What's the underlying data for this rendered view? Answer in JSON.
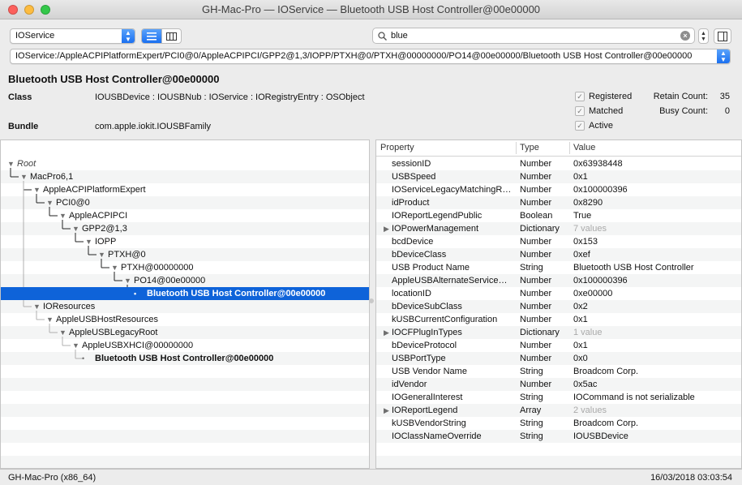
{
  "window": {
    "title": "GH-Mac-Pro — IOService — Bluetooth USB Host Controller@00e00000"
  },
  "toolbar": {
    "plane_select": "IOService",
    "search_value": "blue",
    "path": "IOService:/AppleACPIPlatformExpert/PCI0@0/AppleACPIPCI/GPP2@1,3/IOPP/PTXH@0/PTXH@00000000/PO14@00e00000/Bluetooth USB Host Controller@00e00000"
  },
  "header": {
    "title": "Bluetooth USB Host Controller@00e00000",
    "class_label": "Class",
    "class_value": "IOUSBDevice : IOUSBNub : IOService : IORegistryEntry : OSObject",
    "bundle_label": "Bundle",
    "bundle_value": "com.apple.iokit.IOUSBFamily",
    "registered": "Registered",
    "matched": "Matched",
    "active": "Active",
    "retain_label": "Retain Count:",
    "retain_value": "35",
    "busy_label": "Busy Count:",
    "busy_value": "0"
  },
  "tree": [
    {
      "label": "Root",
      "depth": 0,
      "expanded": true,
      "italic": true
    },
    {
      "label": "MacPro6,1",
      "depth": 1,
      "expanded": true
    },
    {
      "label": "AppleACPIPlatformExpert",
      "depth": 2,
      "expanded": true
    },
    {
      "label": "PCI0@0",
      "depth": 3,
      "expanded": true
    },
    {
      "label": "AppleACPIPCI",
      "depth": 4,
      "expanded": true
    },
    {
      "label": "GPP2@1,3",
      "depth": 5,
      "expanded": true
    },
    {
      "label": "IOPP",
      "depth": 6,
      "expanded": true
    },
    {
      "label": "PTXH@0",
      "depth": 7,
      "expanded": true
    },
    {
      "label": "PTXH@00000000",
      "depth": 8,
      "expanded": true
    },
    {
      "label": "PO14@00e00000",
      "depth": 9,
      "expanded": true
    },
    {
      "label": "Bluetooth USB Host Controller@00e00000",
      "depth": 10,
      "expanded": false,
      "selected": true
    },
    {
      "label": "IOResources",
      "depth": 2,
      "expanded": true
    },
    {
      "label": "AppleUSBHostResources",
      "depth": 3,
      "expanded": true
    },
    {
      "label": "AppleUSBLegacyRoot",
      "depth": 4,
      "expanded": true
    },
    {
      "label": "AppleUSBXHCI@00000000",
      "depth": 5,
      "expanded": true
    },
    {
      "label": "Bluetooth USB Host Controller@00e00000",
      "depth": 6,
      "expanded": false,
      "bold": true
    }
  ],
  "properties": {
    "columns": [
      "Property",
      "Type",
      "Value"
    ],
    "rows": [
      {
        "name": "sessionID",
        "type": "Number",
        "value": "0x63938448"
      },
      {
        "name": "USBSpeed",
        "type": "Number",
        "value": "0x1"
      },
      {
        "name": "IOServiceLegacyMatchingRegistryID",
        "type": "Number",
        "value": "0x100000396"
      },
      {
        "name": "idProduct",
        "type": "Number",
        "value": "0x8290"
      },
      {
        "name": "IOReportLegendPublic",
        "type": "Boolean",
        "value": "True"
      },
      {
        "name": "IOPowerManagement",
        "type": "Dictionary",
        "value": "7 values",
        "expandable": true,
        "muted": true
      },
      {
        "name": "bcdDevice",
        "type": "Number",
        "value": "0x153"
      },
      {
        "name": "bDeviceClass",
        "type": "Number",
        "value": "0xef"
      },
      {
        "name": "USB Product Name",
        "type": "String",
        "value": "Bluetooth USB Host Controller"
      },
      {
        "name": "AppleUSBAlternateServiceRegistryID",
        "type": "Number",
        "value": "0x100000396"
      },
      {
        "name": "locationID",
        "type": "Number",
        "value": "0xe00000"
      },
      {
        "name": "bDeviceSubClass",
        "type": "Number",
        "value": "0x2"
      },
      {
        "name": "kUSBCurrentConfiguration",
        "type": "Number",
        "value": "0x1"
      },
      {
        "name": "IOCFPlugInTypes",
        "type": "Dictionary",
        "value": "1 value",
        "expandable": true,
        "muted": true
      },
      {
        "name": "bDeviceProtocol",
        "type": "Number",
        "value": "0x1"
      },
      {
        "name": "USBPortType",
        "type": "Number",
        "value": "0x0"
      },
      {
        "name": "USB Vendor Name",
        "type": "String",
        "value": "Broadcom Corp."
      },
      {
        "name": "idVendor",
        "type": "Number",
        "value": "0x5ac"
      },
      {
        "name": "IOGeneralInterest",
        "type": "String",
        "value": "IOCommand is not serializable"
      },
      {
        "name": "IOReportLegend",
        "type": "Array",
        "value": "2 values",
        "expandable": true,
        "muted": true
      },
      {
        "name": "kUSBVendorString",
        "type": "String",
        "value": "Broadcom Corp."
      },
      {
        "name": "IOClassNameOverride",
        "type": "String",
        "value": "IOUSBDevice"
      }
    ]
  },
  "status": {
    "host": "GH-Mac-Pro (x86_64)",
    "timestamp": "16/03/2018 03:03:54"
  },
  "colors": {
    "selection": "#0e63d9",
    "accent": "#1a6ff0"
  }
}
